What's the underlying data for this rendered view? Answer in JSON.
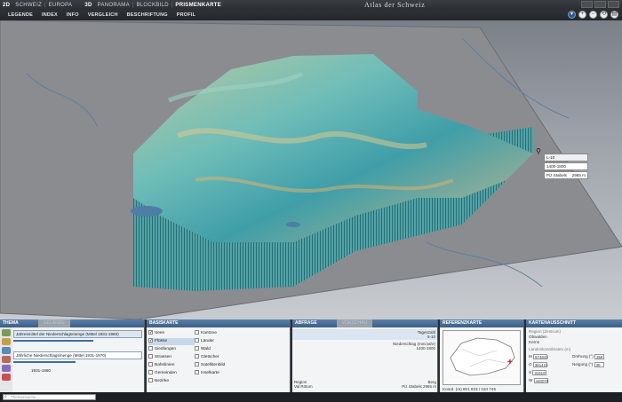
{
  "topbar": {
    "tabs": [
      {
        "label": "2D",
        "active": false
      },
      {
        "label": "SCHWEIZ",
        "active": false
      },
      {
        "label": "EUROPA",
        "active": false
      },
      {
        "label": "3D",
        "active": true
      },
      {
        "label": "PANORAMA",
        "active": false
      },
      {
        "label": "BLOCKBILD",
        "active": false
      },
      {
        "label": "PRISMENKARTE",
        "active": true
      }
    ],
    "app_title": "Atlas der Schweiz"
  },
  "menu": {
    "items": [
      "LEGENDE",
      "INDEX",
      "INFO",
      "VERGLEICH",
      "BESCHRIFTUNG",
      "PROFIL"
    ]
  },
  "tooltip": {
    "line1": "L-10",
    "line2": "1400-1800",
    "line3_label": "Piz Stabels",
    "line3_value": "2965 m"
  },
  "thema": {
    "tab_active": "THEMA",
    "tab_inactive": "GELÄNDE",
    "item1": "Jahresmittel der Niederschlagsmenge (Mittel 1931-1960)",
    "item2": "Jährliche Niederschlagsmenge (Mittel 1931-1970)",
    "slider_label": "1931-1960"
  },
  "basiskarte": {
    "title": "BASISKARTE",
    "items": [
      {
        "label": "Seen",
        "checked": true
      },
      {
        "label": "Kantone",
        "checked": false
      },
      {
        "label": "Flüsse",
        "checked": true
      },
      {
        "label": "Länder",
        "checked": false
      },
      {
        "label": "Siedlungen",
        "checked": false
      },
      {
        "label": "Wald",
        "checked": false
      },
      {
        "label": "Strassen",
        "checked": false
      },
      {
        "label": "Gletscher",
        "checked": false
      },
      {
        "label": "Bahnlinien",
        "checked": false
      },
      {
        "label": "Satellitenbild",
        "checked": false
      },
      {
        "label": "Gemeinden",
        "checked": false
      },
      {
        "label": "Inselkarte",
        "checked": false
      },
      {
        "label": "Bezirke",
        "checked": false
      }
    ]
  },
  "abfrage": {
    "tab_active": "ABFRAGE",
    "tab_inactive": "VORSCHAU",
    "row1_value": "Tageszahl",
    "row2_value": "5-10",
    "row3_label": "Niederschlag (mm/Jahr)",
    "row3_value": "1400-1800",
    "foot_label1": "Region",
    "foot_value1": "Berg",
    "foot_label2": "Val Rötum",
    "foot_value2": "Piz Stabels   2965 m"
  },
  "referenz": {
    "title": "REFERENZKARTE",
    "coord_label": "Koord. (m)",
    "coord_value": "801 823 / 184 745"
  },
  "kartenausschnitt": {
    "title": "KARTENAUSSCHNITT",
    "region_label": "Region (Zentrum)",
    "region_value1": "Obwalden",
    "region_value2": "Kerns",
    "coords_label": "Landeskoordinaten (m)",
    "m_label": "M",
    "m_value": "574843",
    "o_label": "O",
    "o_value": "361422",
    "s_label": "S",
    "s_value": "31519",
    "w_label": "W",
    "w_value": "440076",
    "drehung_label": "Drehung (°)",
    "drehung_value": "358",
    "neigung_label": "Neigung (°)",
    "neigung_value": "30"
  },
  "search": {
    "placeholder": "Themensuche"
  }
}
